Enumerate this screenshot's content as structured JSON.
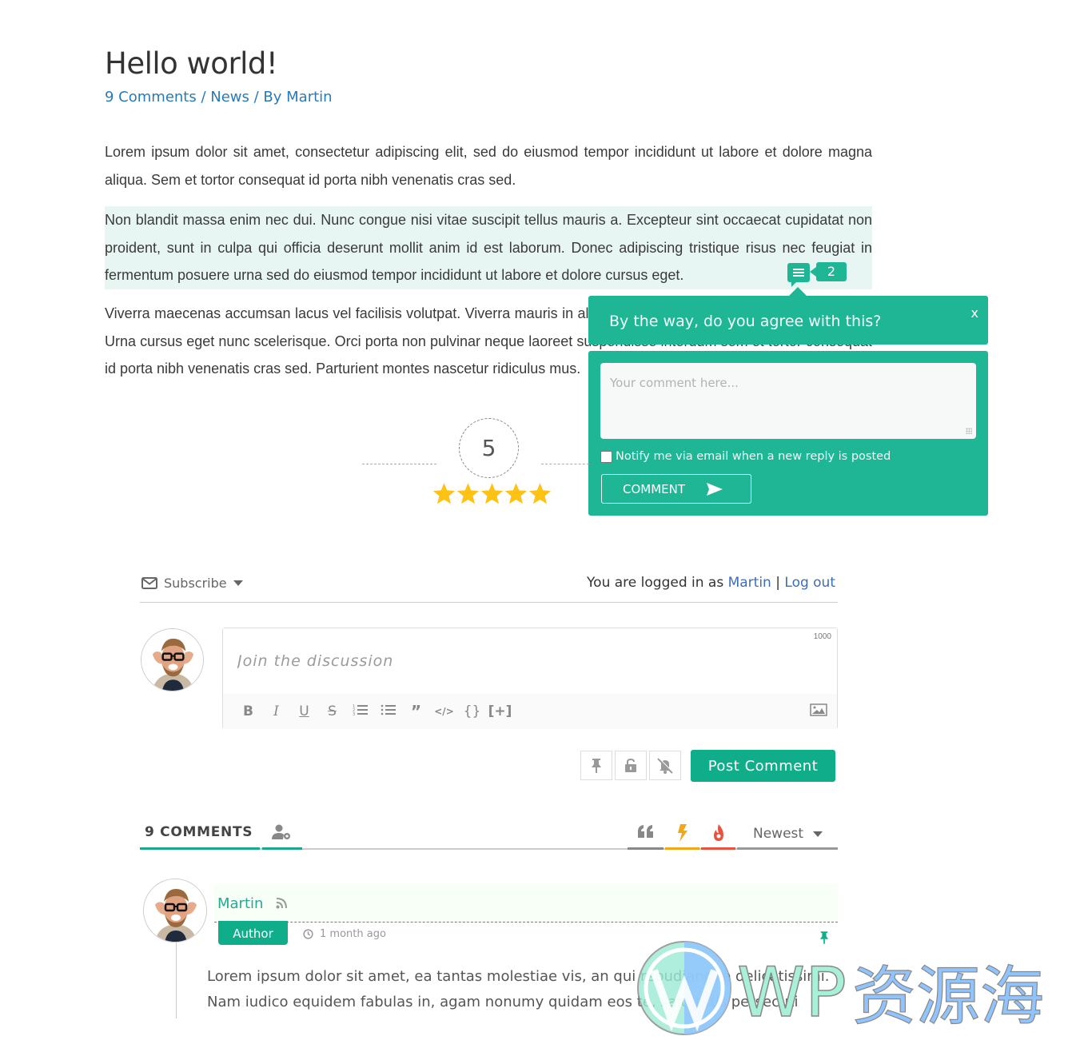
{
  "post": {
    "title": "Hello world!",
    "meta": {
      "comments_link": "9 Comments",
      "separator": " / ",
      "category_link": "News",
      "by_label": "By ",
      "author_link": "Martin"
    },
    "paragraphs": [
      "Lorem ipsum dolor sit amet, consectetur adipiscing elit, sed do eiusmod tempor incididunt ut labore et dolore magna aliqua.  Sem et tortor consequat id porta nibh venenatis cras sed.",
      "Non blandit massa enim nec dui. Nunc congue nisi vitae suscipit tellus mauris a. Excepteur sint occaecat cupidatat non proident, sunt in culpa qui officia deserunt mollit anim id est laborum. Donec adipiscing tristique risus nec feugiat in fermentum posuere urna sed do eiusmod tempor incididunt ut labore et dolore cursus eget.",
      "Viverra maecenas accumsan lacus vel facilisis volutpat. Viverra mauris in aliquam sem fringilla ut morbi tincidunt augue. Urna cursus eget nunc scelerisque. Orci porta non pulvinar neque laoreet suspendisse interdum sem et tortor consequat id porta nibh venenatis cras sed. Parturient montes nascetur ridiculus mus."
    ]
  },
  "inline_feedback": {
    "count": "2",
    "question": "By the way, do you agree with this?",
    "close_label": "x",
    "textarea_placeholder": "Your comment here...",
    "notify_label": "Notify me via email when a new reply is posted",
    "submit_label": "COMMENT"
  },
  "rating": {
    "value": "5",
    "stars": 5,
    "max_stars": 5,
    "star_color": "#fdc213"
  },
  "comment_form": {
    "subscribe_label": "Subscribe",
    "logged_in_prefix": "You are logged in as ",
    "logged_in_user": "Martin",
    "logged_in_sep": " | ",
    "logout_label": "Log out",
    "placeholder": "Join the discussion",
    "char_limit": "1000",
    "toolbar": [
      "B",
      "I",
      "U",
      "S",
      "ol",
      "ul",
      "quote",
      "code",
      "{}",
      "[+]"
    ],
    "post_button": "Post Comment",
    "accent_color": "#10ad8a"
  },
  "thread": {
    "comments_tab": "9 COMMENTS",
    "sort_label": "Newest"
  },
  "comments": [
    {
      "author": "Martin",
      "badge": "Author",
      "time": "1 month ago",
      "text": "Lorem ipsum dolor sit amet, ea tantas molestiae vis, an qui repudiandae delicatissimi. Nam iudico equidem fabulas in, agam nonumy quidam eos te, salutatus persecuti"
    }
  ],
  "watermark": {
    "text": "WP资源海"
  }
}
